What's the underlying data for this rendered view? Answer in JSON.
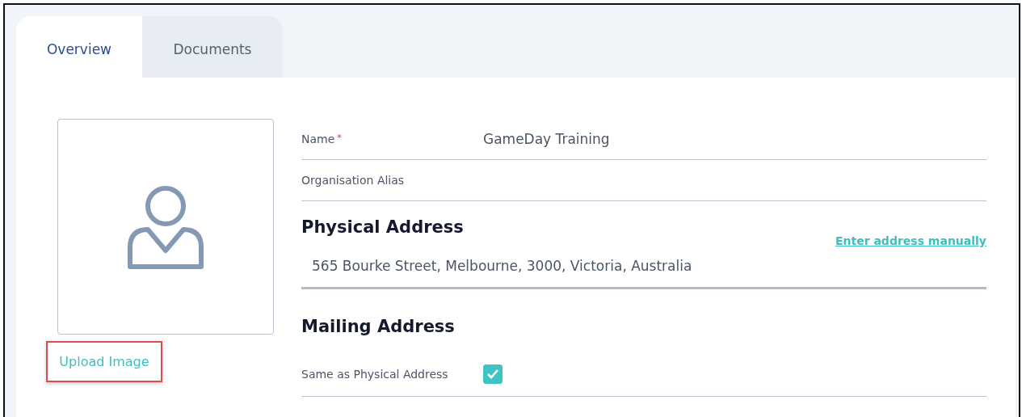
{
  "tabs": [
    {
      "label": "Overview",
      "selected": true
    },
    {
      "label": "Documents",
      "selected": false
    }
  ],
  "upload": {
    "label": "Upload Image",
    "highlighted": true
  },
  "fields": [
    {
      "label": "Name",
      "required_mark": "*",
      "value": "GameDay Training"
    },
    {
      "label": "Organisation Alias"
    }
  ],
  "physical_address": {
    "heading": "Physical Address",
    "link": "Enter address manually",
    "value": "565 Bourke Street, Melbourne, 3000, Victoria, Australia"
  },
  "mailing_address": {
    "heading": "Mailing Address",
    "same_as_label": "Same as Physical Address",
    "checked": true
  }
}
